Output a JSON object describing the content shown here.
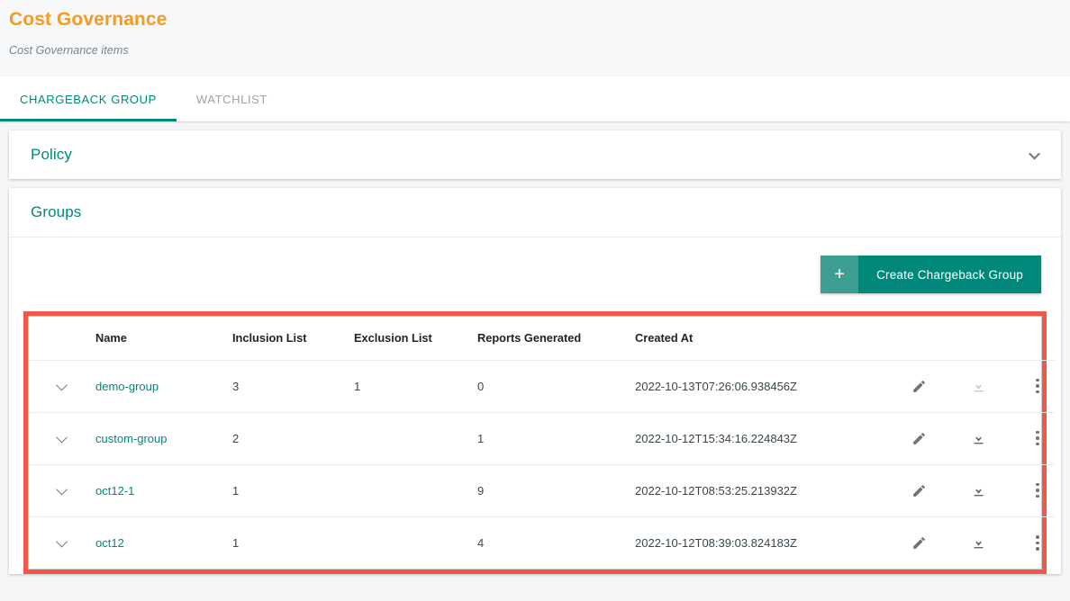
{
  "header": {
    "title": "Cost Governance",
    "subtitle": "Cost Governance items",
    "title_color": "#f79a1f"
  },
  "tabs": [
    {
      "label": "CHARGEBACK GROUP",
      "active": true
    },
    {
      "label": "WATCHLIST",
      "active": false
    }
  ],
  "accent_color": "#00897b",
  "highlight_color": "#f0584b",
  "policy_panel": {
    "heading": "Policy",
    "expand_icon": "chevron-down-icon",
    "expanded": false
  },
  "groups_panel": {
    "heading": "Groups",
    "create_button": {
      "icon": "plus-icon",
      "plus_glyph": "+",
      "label": "Create Chargeback Group"
    },
    "table": {
      "columns": [
        {
          "key": "expand",
          "label": ""
        },
        {
          "key": "name",
          "label": "Name"
        },
        {
          "key": "inclusion",
          "label": "Inclusion List"
        },
        {
          "key": "exclusion",
          "label": "Exclusion List"
        },
        {
          "key": "reports",
          "label": "Reports Generated"
        },
        {
          "key": "created",
          "label": "Created At"
        },
        {
          "key": "actions",
          "label": ""
        }
      ],
      "rows": [
        {
          "name": "demo-group",
          "inclusion": "3",
          "exclusion": "1",
          "reports": "0",
          "created": "2022-10-13T07:26:06.938456Z",
          "download_enabled": false
        },
        {
          "name": "custom-group",
          "inclusion": "2",
          "exclusion": "",
          "reports": "1",
          "created": "2022-10-12T15:34:16.224843Z",
          "download_enabled": true
        },
        {
          "name": "oct12-1",
          "inclusion": "1",
          "exclusion": "",
          "reports": "9",
          "created": "2022-10-12T08:53:25.213932Z",
          "download_enabled": true
        },
        {
          "name": "oct12",
          "inclusion": "1",
          "exclusion": "",
          "reports": "4",
          "created": "2022-10-12T08:39:03.824183Z",
          "download_enabled": true
        }
      ],
      "row_icons": {
        "expand": "chevron-down-icon",
        "edit": "pencil-icon",
        "download": "download-icon",
        "more": "more-vertical-icon"
      }
    }
  }
}
